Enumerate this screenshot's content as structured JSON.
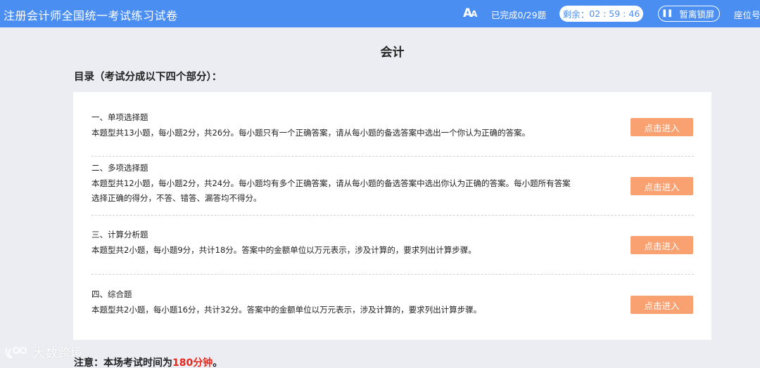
{
  "header": {
    "app_title": "注册会计师全国统一考试练习试卷",
    "font_icon": "font-size-icon",
    "progress": "已完成0/29题",
    "timer_label": "剩余：",
    "timer_value": "02 : 59 : 46",
    "pause_label": "暂离锁屏",
    "seat_label": "座位号"
  },
  "subject": "会计",
  "toc_heading": "目录（考试分成以下四个部分）：",
  "sections": [
    {
      "title": "一、单项选择题",
      "desc": "本题型共13小题，每小题2分，共26分。每小题只有一个正确答案，请从每小题的备选答案中选出一个你认为正确的答案。",
      "button": "点击进入"
    },
    {
      "title": "二、多项选择题",
      "desc": "本题型共12小题，每小题2分，共24分。每小题均有多个正确答案，请从每小题的备选答案中选出你认为正确的答案。每小题所有答案选择正确的得分，不答、错答、漏答均不得分。",
      "button": "点击进入"
    },
    {
      "title": "三、计算分析题",
      "desc": "本题型共2小题，每小题9分，共计18分。答案中的金额单位以万元表示，涉及计算的，要求列出计算步骤。",
      "button": "点击进入"
    },
    {
      "title": "四、综合题",
      "desc": "本题型共2小题，每小题16分，共计32分。答案中的金额单位以万元表示，涉及计算的，要求列出计算步骤。",
      "button": "点击进入"
    }
  ],
  "notice": {
    "prefix": "注意：本场考试时间为",
    "highlight": "180分钟",
    "suffix": "。"
  },
  "watermark": "大数跨境",
  "colors": {
    "header_bg": "#4b8ef2",
    "button_bg": "#f9a170",
    "highlight": "#e8261a",
    "page_bg": "#ecedf2"
  }
}
